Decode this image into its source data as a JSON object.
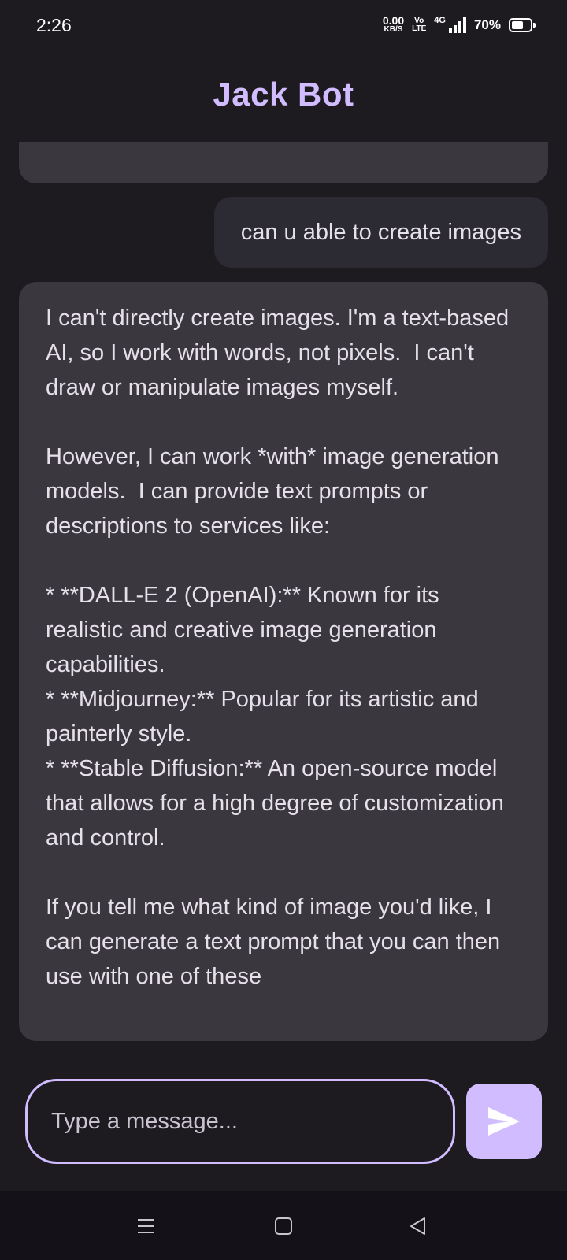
{
  "status_bar": {
    "time": "2:26",
    "net_speed_value": "0.00",
    "net_speed_unit": "KB/S",
    "volte_top": "Vo",
    "volte_bottom": "LTE",
    "network": "4G",
    "battery_text": "70%",
    "battery_level": 0.7
  },
  "app_bar": {
    "title": "Jack Bot"
  },
  "chat": {
    "messages": [
      {
        "role": "user",
        "text": "can u able to create images"
      },
      {
        "role": "bot",
        "text": "I can't directly create images. I'm a text-based AI, so I work with words, not pixels.  I can't draw or manipulate images myself.\n\nHowever, I can work *with* image generation models.  I can provide text prompts or descriptions to services like:\n\n* **DALL-E 2 (OpenAI):** Known for its realistic and creative image generation capabilities.\n* **Midjourney:** Popular for its artistic and painterly style.\n* **Stable Diffusion:** An open-source model that allows for a high degree of customization and control.\n\nIf you tell me what kind of image you'd like, I can generate a text prompt that you can then use with one of these"
      }
    ]
  },
  "composer": {
    "placeholder": "Type a message...",
    "value": ""
  },
  "colors": {
    "background": "#1d1b20",
    "accent": "#d0bcff",
    "bot_bubble": "#3a373f",
    "user_bubble": "#2c2a33"
  },
  "nav_bar": {
    "recents_icon": "menu-icon",
    "home_icon": "square-icon",
    "back_icon": "triangle-back-icon"
  }
}
